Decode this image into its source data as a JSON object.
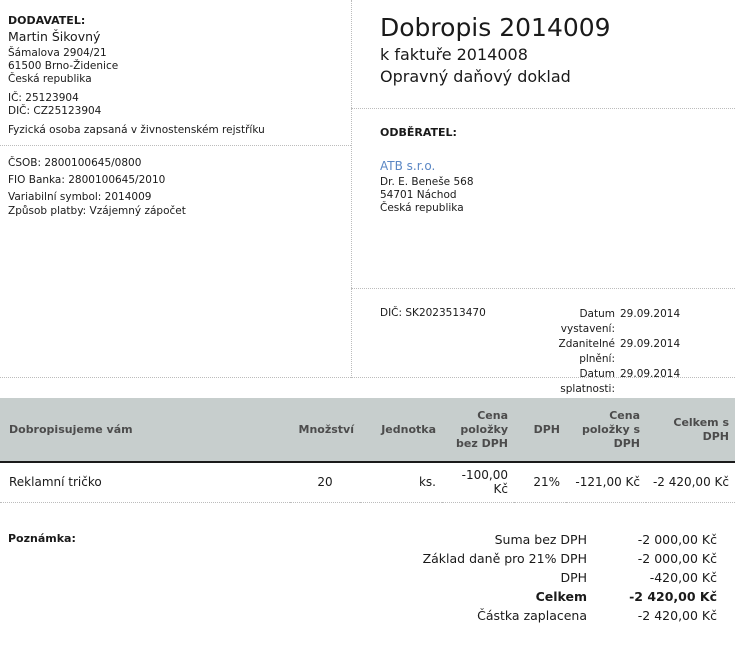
{
  "supplier": {
    "heading": "DODAVATEL:",
    "name": "Martin Šikovný",
    "street": "Šámalova 2904/21",
    "city": "61500 Brno-Židenice",
    "country": "Česká republika",
    "ic": "IČ: 25123904",
    "dic": "DIČ: CZ25123904",
    "registration": "Fyzická osoba zapsaná v živnostenském rejstříku"
  },
  "bank": {
    "csob": "ČSOB: 2800100645/0800",
    "fio": "FIO Banka: 2800100645/2010",
    "variable_symbol": "Variabilní symbol: 2014009",
    "payment_method": "Způsob platby: Vzájemný zápočet"
  },
  "document": {
    "title": "Dobropis 2014009",
    "invoice_ref": "k faktuře 2014008",
    "doc_type": "Opravný daňový doklad"
  },
  "customer": {
    "heading": "ODBĚRATEL:",
    "name": "ATB s.r.o.",
    "street": "Dr. E. Beneše 568",
    "city": "54701 Náchod",
    "country": "Česká republika",
    "dic": "DIČ: SK2023513470"
  },
  "dates": [
    {
      "label": "Datum vystavení:",
      "value": "29.09.2014"
    },
    {
      "label": "Zdanitelné plnění:",
      "value": "29.09.2014"
    },
    {
      "label": "Datum splatnosti:",
      "value": "29.09.2014"
    }
  ],
  "items_table": {
    "headers": {
      "description": "Dobropisujeme vám",
      "quantity": "Množství",
      "unit": "Jednotka",
      "price_excl": [
        "Cena",
        "položky",
        "bez DPH"
      ],
      "vat": "DPH",
      "price_incl": [
        "Cena",
        "položky s",
        "DPH"
      ],
      "total": [
        "Celkem s",
        "DPH"
      ]
    },
    "rows": [
      {
        "description": "Reklamní tričko",
        "quantity": "20",
        "unit": "ks.",
        "price_excl": "-100,00 Kč",
        "vat": "21%",
        "price_incl": "-121,00 Kč",
        "total": "-2 420,00 Kč"
      }
    ]
  },
  "note_label": "Poznámka:",
  "summary": [
    {
      "label": "Suma bez DPH",
      "value": "-2 000,00 Kč"
    },
    {
      "label": "Základ daně pro 21% DPH",
      "value": "-2 000,00 Kč"
    },
    {
      "label": "DPH",
      "value": "-420,00 Kč"
    },
    {
      "label": "Celkem",
      "value": "-2 420,00 Kč"
    },
    {
      "label": "Částka zaplacena",
      "value": "-2 420,00 Kč"
    }
  ]
}
